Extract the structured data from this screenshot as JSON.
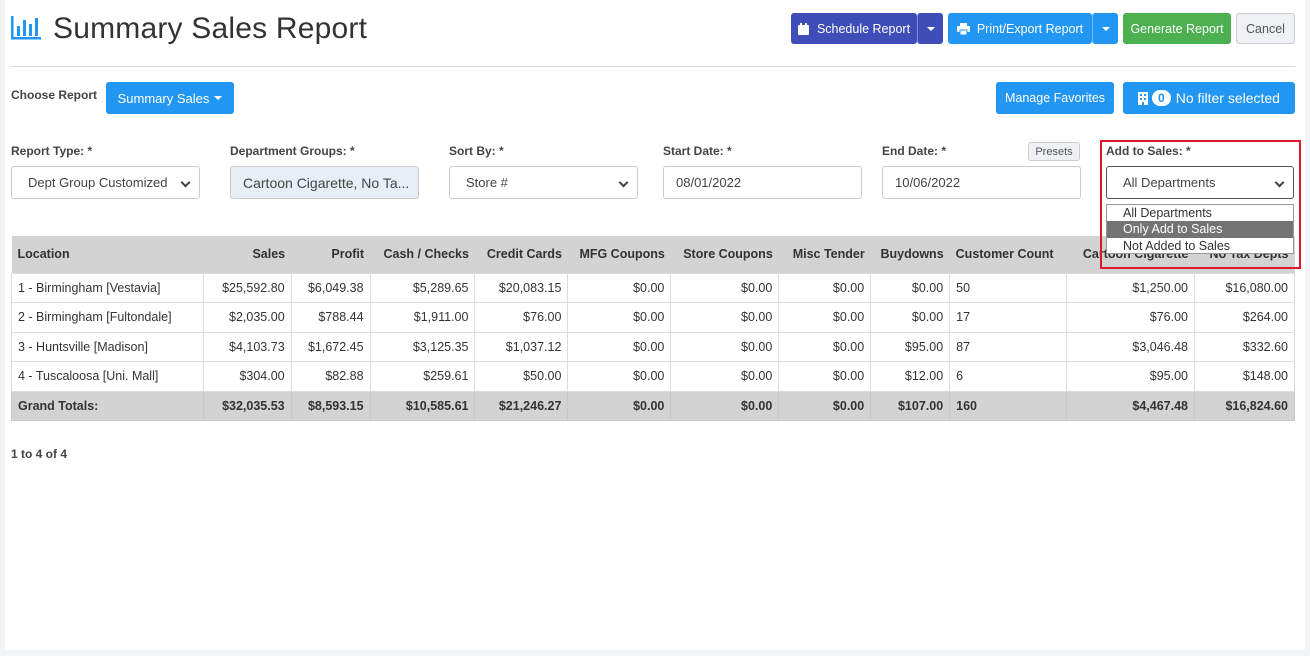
{
  "header": {
    "title": "Summary Sales Report",
    "schedule_label": "Schedule Report",
    "print_label": "Print/Export Report",
    "generate_label": "Generate Report",
    "cancel_label": "Cancel"
  },
  "toolbar": {
    "choose_report_label": "Choose Report",
    "summary_sales_label": "Summary Sales",
    "manage_favorites_label": "Manage Favorites",
    "filter_count": "0",
    "filter_label": "No filter selected"
  },
  "filters": {
    "report_type_label": "Report Type: *",
    "report_type_value": "Dept Group Customized",
    "dept_groups_label": "Department Groups: *",
    "dept_groups_value": "Cartoon Cigarette, No Ta...",
    "sort_by_label": "Sort By: *",
    "sort_by_value": "Store #",
    "start_date_label": "Start Date: *",
    "start_date_value": "08/01/2022",
    "end_date_label": "End Date: *",
    "end_date_value": "10/06/2022",
    "presets_label": "Presets",
    "add_to_sales_label": "Add to Sales: *",
    "add_to_sales_value": "All Departments",
    "add_to_sales_options": [
      "All Departments",
      "Only Add to Sales",
      "Not Added to Sales"
    ]
  },
  "table": {
    "columns": [
      "Location",
      "Sales",
      "Profit",
      "Cash / Checks",
      "Credit Cards",
      "MFG Coupons",
      "Store Coupons",
      "Misc Tender",
      "Buydowns",
      "Customer Count",
      "Cartoon Cigarette",
      "No Tax Depts"
    ],
    "rows": [
      [
        "1 - Birmingham [Vestavia]",
        "$25,592.80",
        "$6,049.38",
        "$5,289.65",
        "$20,083.15",
        "$0.00",
        "$0.00",
        "$0.00",
        "$0.00",
        "50",
        "$1,250.00",
        "$16,080.00"
      ],
      [
        "2 - Birmingham [Fultondale]",
        "$2,035.00",
        "$788.44",
        "$1,911.00",
        "$76.00",
        "$0.00",
        "$0.00",
        "$0.00",
        "$0.00",
        "17",
        "$76.00",
        "$264.00"
      ],
      [
        "3 - Huntsville [Madison]",
        "$4,103.73",
        "$1,672.45",
        "$3,125.35",
        "$1,037.12",
        "$0.00",
        "$0.00",
        "$0.00",
        "$95.00",
        "87",
        "$3,046.48",
        "$332.60"
      ],
      [
        "4 - Tuscaloosa [Uni. Mall]",
        "$304.00",
        "$82.88",
        "$259.61",
        "$50.00",
        "$0.00",
        "$0.00",
        "$0.00",
        "$12.00",
        "6",
        "$95.00",
        "$148.00"
      ]
    ],
    "totals": [
      "Grand Totals:",
      "$32,035.53",
      "$8,593.15",
      "$10,585.61",
      "$21,246.27",
      "$0.00",
      "$0.00",
      "$0.00",
      "$107.00",
      "160",
      "$4,467.48",
      "$16,824.60"
    ]
  },
  "pager": {
    "text": "1 to 4 of 4"
  },
  "colors": {
    "schedule": "#3f4db8",
    "primary": "#2196f3",
    "generate": "#4caf50",
    "highlight": "#e0182d"
  }
}
